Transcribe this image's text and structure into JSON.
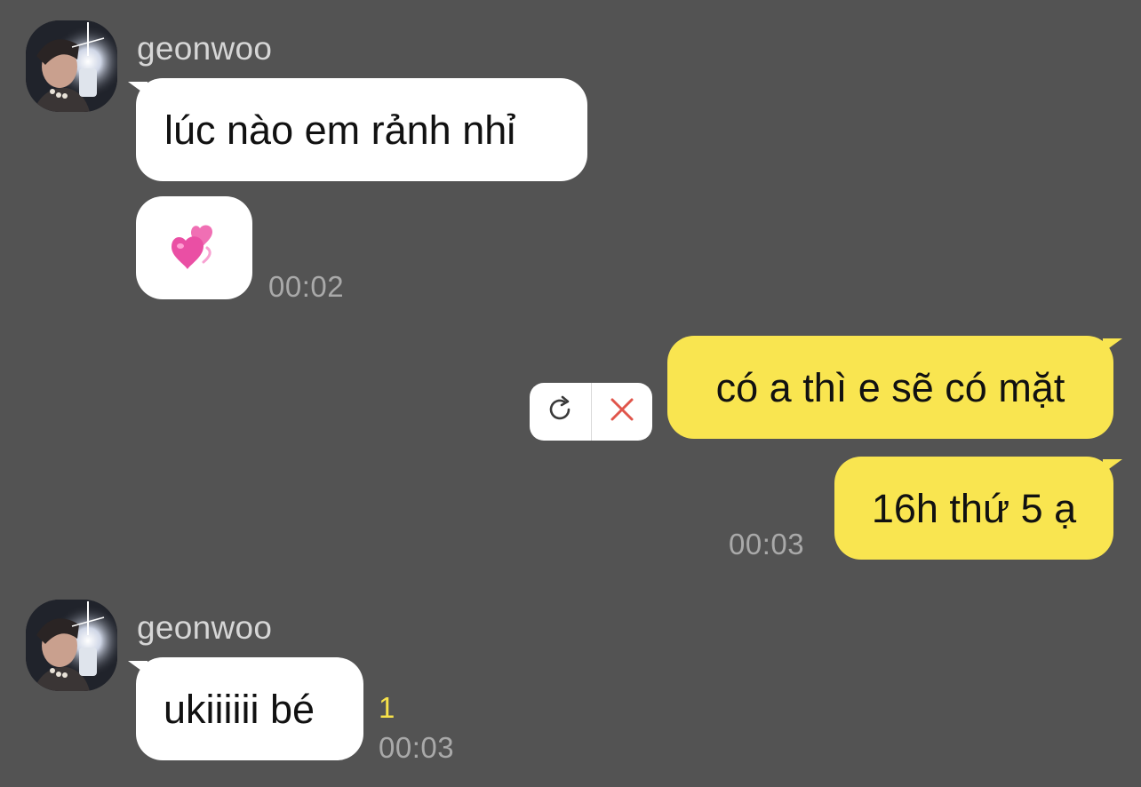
{
  "colors": {
    "background": "#535353",
    "incoming_bubble": "#ffffff",
    "outgoing_bubble": "#f9e550",
    "timestamp": "#a9a9a9",
    "unread": "#f7e24a",
    "delete_x": "#e0554b"
  },
  "messages": {
    "group1": {
      "sender": "geonwoo",
      "text1": "lúc nào em rảnh nhỉ",
      "emoji_icon": "two-hearts-icon",
      "time": "00:02"
    },
    "group2": {
      "text1": "có a thì e sẽ có mặt",
      "text2": "16h thứ 5 ạ",
      "time": "00:03",
      "failed_actions": {
        "retry_icon": "retry-icon",
        "delete_icon": "close-icon"
      }
    },
    "group3": {
      "sender": "geonwoo",
      "text1": "ukiiiiii bé",
      "unread": "1",
      "time": "00:03"
    }
  }
}
